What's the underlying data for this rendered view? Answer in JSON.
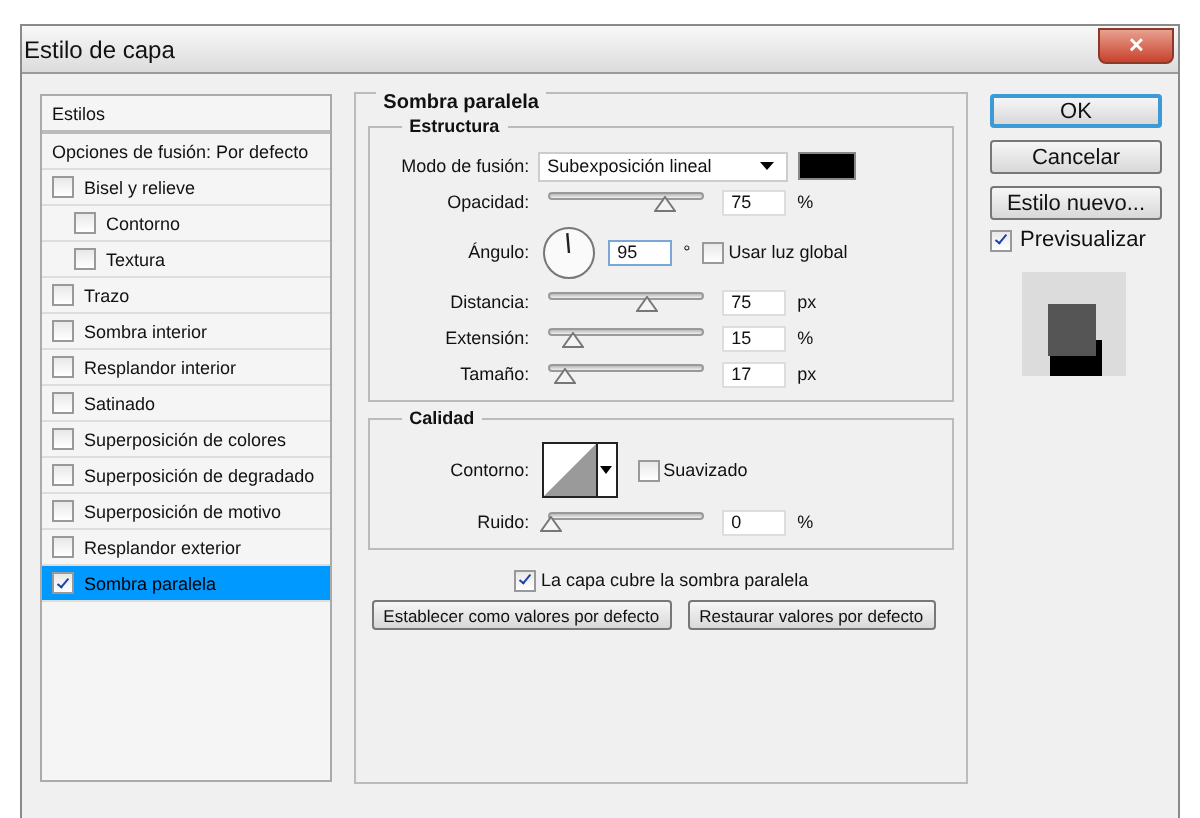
{
  "window": {
    "title": "Estilo de capa",
    "close": "✕"
  },
  "styles": {
    "header": "Estilos",
    "blend_options": {
      "label": "Opciones de fusión: Por defecto",
      "selected": false
    },
    "items": [
      {
        "label": "Bisel y relieve",
        "checked": false,
        "selected": false,
        "children": [
          {
            "label": "Contorno",
            "checked": false,
            "selected": false
          },
          {
            "label": "Textura",
            "checked": false,
            "selected": false
          }
        ]
      },
      {
        "label": "Trazo",
        "checked": false,
        "selected": false
      },
      {
        "label": "Sombra interior",
        "checked": false,
        "selected": false
      },
      {
        "label": "Resplandor interior",
        "checked": false,
        "selected": false
      },
      {
        "label": "Satinado",
        "checked": false,
        "selected": false
      },
      {
        "label": "Superposición de colores",
        "checked": false,
        "selected": false
      },
      {
        "label": "Superposición de degradado",
        "checked": false,
        "selected": false
      },
      {
        "label": "Superposición de motivo",
        "checked": false,
        "selected": false
      },
      {
        "label": "Resplandor exterior",
        "checked": false,
        "selected": false
      },
      {
        "label": "Sombra paralela",
        "checked": true,
        "selected": true
      }
    ]
  },
  "panel": {
    "title": "Sombra paralela",
    "structure": {
      "title": "Estructura",
      "rows": [
        {
          "kind": "dropdown",
          "label": "Modo de fusión:",
          "value": "Subexposición lineal",
          "color": "#000000"
        },
        {
          "kind": "slider",
          "label": "Opacidad:",
          "level": 0.75,
          "value": "75",
          "unit": "%"
        },
        {
          "kind": "angle",
          "label": "Ángulo:",
          "value": "95",
          "unit": "°",
          "checkbox": {
            "label": "Usar luz global",
            "checked": false
          }
        },
        {
          "kind": "slider",
          "label": "Distancia:",
          "level": 0.63,
          "value": "75",
          "unit": "px"
        },
        {
          "kind": "slider",
          "label": "Extensión:",
          "level": 0.15,
          "value": "15",
          "unit": "%"
        },
        {
          "kind": "slider",
          "label": "Tamaño:",
          "level": 0.1,
          "value": "17",
          "unit": "px"
        }
      ]
    },
    "quality": {
      "title": "Calidad",
      "rows": [
        {
          "kind": "contour",
          "label": "Contorno:",
          "checkbox": {
            "label": "Suavizado",
            "checked": false
          }
        },
        {
          "kind": "slider",
          "label": "Ruido:",
          "level": 0,
          "value": "0",
          "unit": "%"
        }
      ]
    },
    "knockout": {
      "label": "La capa cubre la sombra paralela",
      "checked": true
    },
    "buttons": [
      "Establecer como valores por defecto",
      "Restaurar valores por defecto"
    ]
  },
  "actions": {
    "buttons": [
      {
        "label": "OK",
        "default": true
      },
      {
        "label": "Cancelar",
        "default": false
      },
      {
        "label": "Estilo nuevo...",
        "default": false
      }
    ],
    "preview": {
      "label": "Previsualizar",
      "checked": true
    }
  }
}
